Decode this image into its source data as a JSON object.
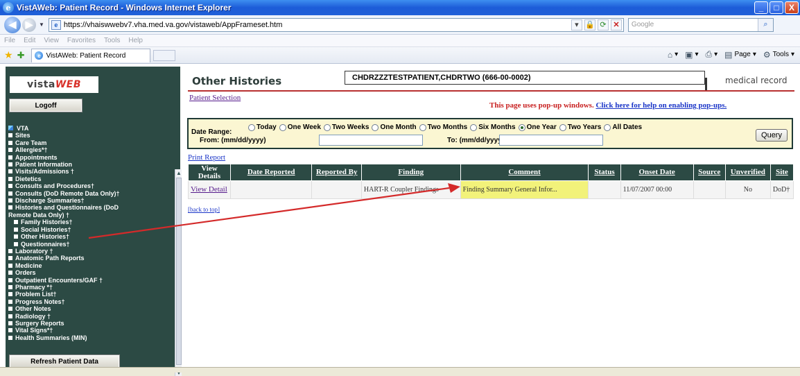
{
  "window": {
    "title": "VistAWeb: Patient Record - Windows Internet Explorer",
    "controls": [
      "_",
      "□",
      "X"
    ]
  },
  "address": {
    "url": "https://vhaiswwebv7.vha.med.va.gov/vistaweb/AppFrameset.htm",
    "search_placeholder": "Google"
  },
  "menu": [
    "File",
    "Edit",
    "View",
    "Favorites",
    "Tools",
    "Help"
  ],
  "tabs": [
    {
      "label": "VistAWeb: Patient Record"
    }
  ],
  "commands": {
    "page": "Page",
    "tools": "Tools"
  },
  "sidebar": {
    "logo_a": "vista",
    "logo_b": "WEB",
    "logoff": "Logoff",
    "refresh": "Refresh Patient Data",
    "items": [
      {
        "label": "VTA",
        "sub": false,
        "vta": true
      },
      {
        "label": "Sites",
        "sub": false
      },
      {
        "label": "Care Team",
        "sub": false
      },
      {
        "label": "Allergies*†",
        "sub": false
      },
      {
        "label": "Appointments",
        "sub": false
      },
      {
        "label": "Patient Information",
        "sub": false
      },
      {
        "label": "Visits/Admissions †",
        "sub": false
      },
      {
        "label": "Dietetics",
        "sub": false
      },
      {
        "label": "Consults and Procedures†",
        "sub": false
      },
      {
        "label": "Consults (DoD Remote Data Only)†",
        "sub": false
      },
      {
        "label": "Discharge Summaries†",
        "sub": false
      },
      {
        "label": "Histories and Questionnaires (DoD",
        "sub": false
      },
      {
        "label": "Remote Data Only) †",
        "sub": false,
        "cont": true
      },
      {
        "label": "Family Histories†",
        "sub": true
      },
      {
        "label": "Social Histories†",
        "sub": true
      },
      {
        "label": "Other Histories†",
        "sub": true
      },
      {
        "label": "Questionnaires†",
        "sub": true
      },
      {
        "label": "Laboratory †",
        "sub": false
      },
      {
        "label": "Anatomic Path Reports",
        "sub": false
      },
      {
        "label": "Medicine",
        "sub": false
      },
      {
        "label": "Orders",
        "sub": false
      },
      {
        "label": "Outpatient Encounters/GAF †",
        "sub": false
      },
      {
        "label": "Pharmacy *†",
        "sub": false
      },
      {
        "label": "Problem List†",
        "sub": false
      },
      {
        "label": "Progress Notes†",
        "sub": false
      },
      {
        "label": "Other Notes",
        "sub": false
      },
      {
        "label": "Radiology †",
        "sub": false
      },
      {
        "label": "Surgery Reports",
        "sub": false
      },
      {
        "label": "Vital Signs*†",
        "sub": false
      },
      {
        "label": "Health Summaries (MIN)",
        "sub": false
      }
    ]
  },
  "main": {
    "title": "Other Histories",
    "patient": "CHDRZZZTESTPATIENT,CHDRTWO (666-00-0002)",
    "medical_record": "medical record",
    "patient_selection": "Patient Selection",
    "popup_text": "This page uses pop-up windows.",
    "popup_link": "Click here for help on enabling pop-ups.",
    "date_range_label": "Date Range:",
    "from_label": "From: (mm/dd/yyyy)",
    "to_label": "To: (mm/dd/yyyy)",
    "query": "Query",
    "ranges": [
      {
        "label": "Today",
        "checked": false
      },
      {
        "label": "One Week",
        "checked": false
      },
      {
        "label": "Two Weeks",
        "checked": false
      },
      {
        "label": "One Month",
        "checked": false
      },
      {
        "label": "Two Months",
        "checked": false
      },
      {
        "label": "Six Months",
        "checked": false
      },
      {
        "label": "One Year",
        "checked": true
      },
      {
        "label": "Two Years",
        "checked": false
      },
      {
        "label": "All Dates",
        "checked": false
      }
    ],
    "print_report": "Print Report",
    "back_to_top": "[back to top]"
  },
  "table": {
    "headers": {
      "view_details": "View Details",
      "date_reported": "Date Reported",
      "reported_by": "Reported By",
      "finding": "Finding",
      "comment": "Comment",
      "status": "Status",
      "onset_date": "Onset Date",
      "source": "Source",
      "unverified": "Unverified",
      "site": "Site"
    },
    "rows": [
      {
        "view_details": "View Detail",
        "date_reported": "",
        "reported_by": "",
        "finding": "HART-R Coupler Findings",
        "comment": "Finding Summary General Infor...",
        "status": "",
        "onset_date": "11/07/2007 00:00",
        "source": "",
        "unverified": "No",
        "site": "DoD†"
      }
    ]
  },
  "annotation": {
    "color": "#d42a2a"
  }
}
